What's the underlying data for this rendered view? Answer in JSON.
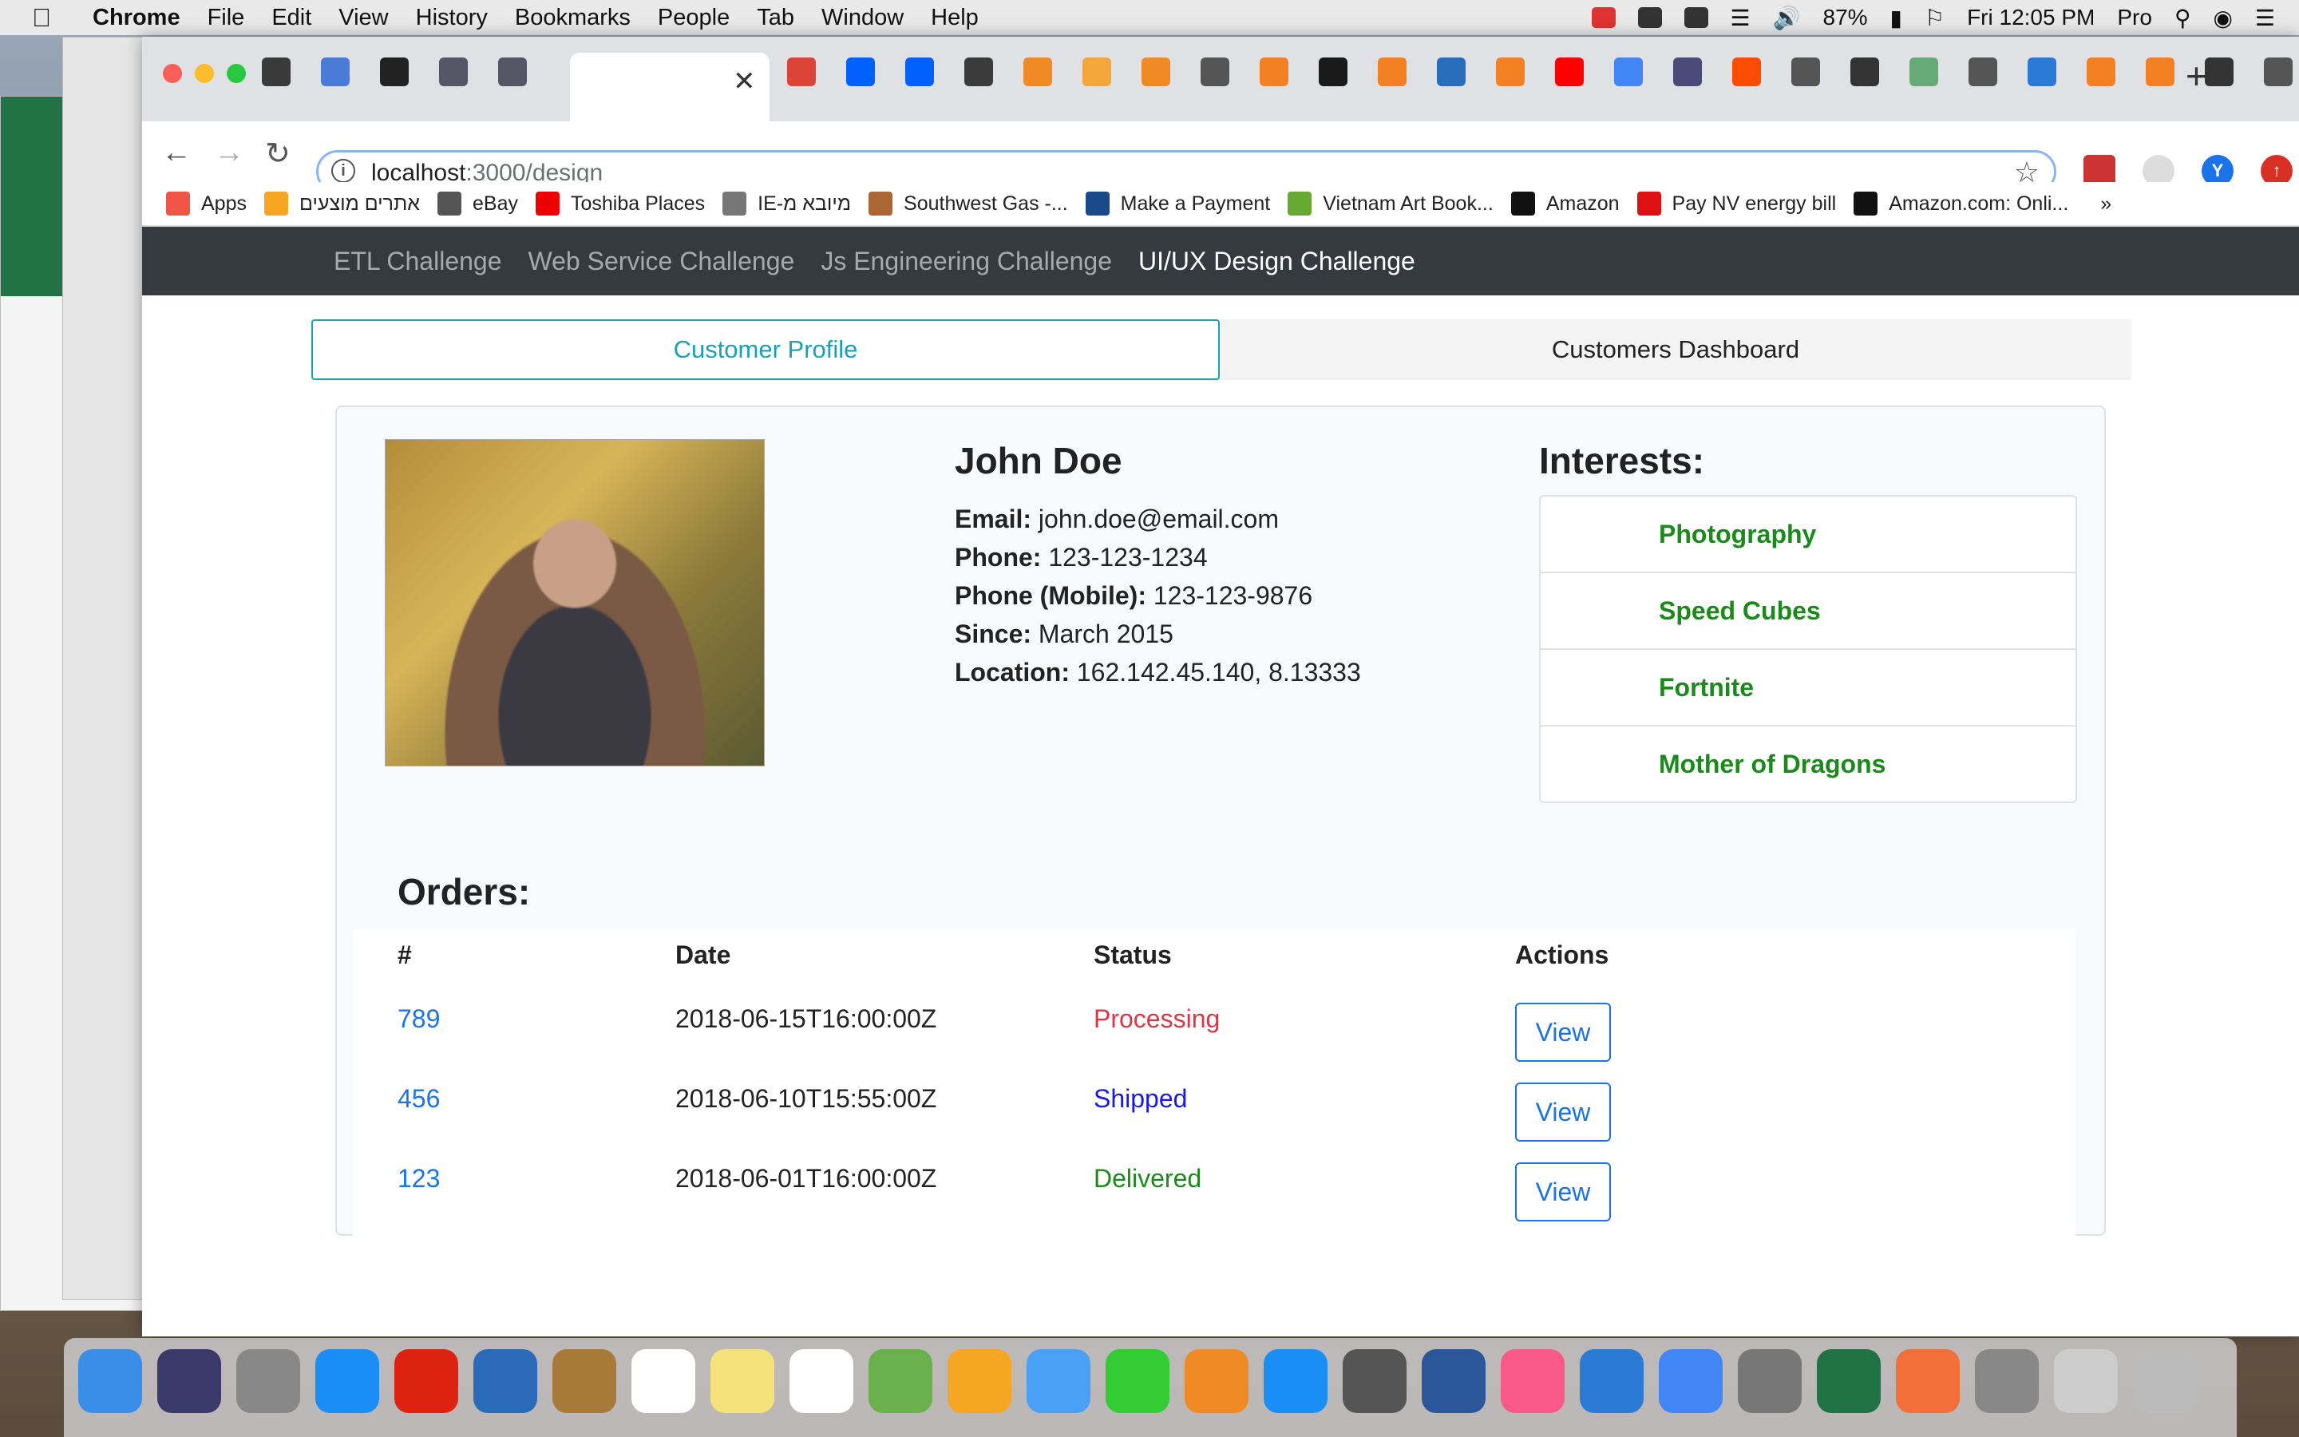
{
  "menubar": {
    "app": "Chrome",
    "items": [
      "File",
      "Edit",
      "View",
      "History",
      "Bookmarks",
      "People",
      "Tab",
      "Window",
      "Help"
    ],
    "battery": "87%",
    "clock": "Fri 12:05 PM",
    "user": "Pro"
  },
  "browser": {
    "url_host": "localhost",
    "url_path": ":3000/design",
    "profile_initial": "Y",
    "tab_colors": [
      "#3a3a3a",
      "#4a7bd6",
      "#222",
      "#556",
      "#556",
      "#fff",
      "#db4437",
      "#0061fe",
      "#0061fe",
      "#3b3b3b",
      "#f08a24",
      "#f2a63b",
      "#f08a24",
      "#555",
      "#f48024",
      "#1a1a1a",
      "#f48024",
      "#2a6ebb",
      "#f48024",
      "#ff0000",
      "#4285f4",
      "#4b4b7a",
      "#fc4c02",
      "#555",
      "#333",
      "#6a7",
      "#555",
      "#2b7bd6",
      "#f48024",
      "#f48024",
      "#333",
      "#555"
    ],
    "bookmarks": [
      {
        "label": "Apps",
        "color": "#e54"
      },
      {
        "label": "אתרים מוצעים",
        "color": "#f5a623"
      },
      {
        "label": "eBay",
        "color": "#555"
      },
      {
        "label": "Toshiba Places",
        "color": "#e00"
      },
      {
        "label": "IE-מיובא מ",
        "color": "#777"
      },
      {
        "label": "Southwest Gas -...",
        "color": "#a63"
      },
      {
        "label": "Make a Payment",
        "color": "#1a4a8a"
      },
      {
        "label": "Vietnam Art Book...",
        "color": "#6a3"
      },
      {
        "label": "Amazon",
        "color": "#111"
      },
      {
        "label": "Pay NV energy bill",
        "color": "#d11"
      },
      {
        "label": "Amazon.com: Onli...",
        "color": "#111"
      }
    ],
    "bookmarks_more": "»"
  },
  "appnav": {
    "links": [
      "ETL Challenge",
      "Web Service Challenge",
      "Js Engineering Challenge",
      "UI/UX Design Challenge"
    ],
    "active_index": 3
  },
  "tabs": {
    "profile": "Customer Profile",
    "dashboard": "Customers Dashboard"
  },
  "profile": {
    "name": "John Doe",
    "email_label": "Email:",
    "email": "john.doe@email.com",
    "phone_label": "Phone:",
    "phone": "123-123-1234",
    "mobile_label": "Phone (Mobile):",
    "mobile": "123-123-9876",
    "since_label": "Since:",
    "since": "March 2015",
    "location_label": "Location:",
    "location": "162.142.45.140, 8.13333"
  },
  "interests": {
    "title": "Interests:",
    "items": [
      "Photography",
      "Speed Cubes",
      "Fortnite",
      "Mother of Dragons"
    ]
  },
  "orders": {
    "title": "Orders:",
    "headers": [
      "#",
      "Date",
      "Status",
      "Actions"
    ],
    "rows": [
      {
        "id": "789",
        "date": "2018-06-15T16:00:00Z",
        "status": "Processing",
        "status_color": "#dc3545",
        "action": "View"
      },
      {
        "id": "456",
        "date": "2018-06-10T15:55:00Z",
        "status": "Shipped",
        "status_color": "#1a1ae0",
        "action": "View"
      },
      {
        "id": "123",
        "date": "2018-06-01T16:00:00Z",
        "status": "Delivered",
        "status_color": "#1a8a1a",
        "action": "View"
      }
    ]
  },
  "dock": {
    "icon_colors": [
      "#3a8ee8",
      "#3a3a6a",
      "#888",
      "#1a8ef5",
      "#d21",
      "#2a6ab8",
      "#a87a3a",
      "#fff",
      "#f5e27a",
      "#fff",
      "#6ab04c",
      "#f5a623",
      "#4aa0f5",
      "#3c3",
      "#f08a24",
      "#1a8ef5",
      "#555",
      "#2b579a",
      "#fa5a8a",
      "#2a7ad6",
      "#4285f4",
      "#777",
      "#217346",
      "#f26f3a",
      "#888",
      "#ccc",
      "#bbb"
    ]
  }
}
